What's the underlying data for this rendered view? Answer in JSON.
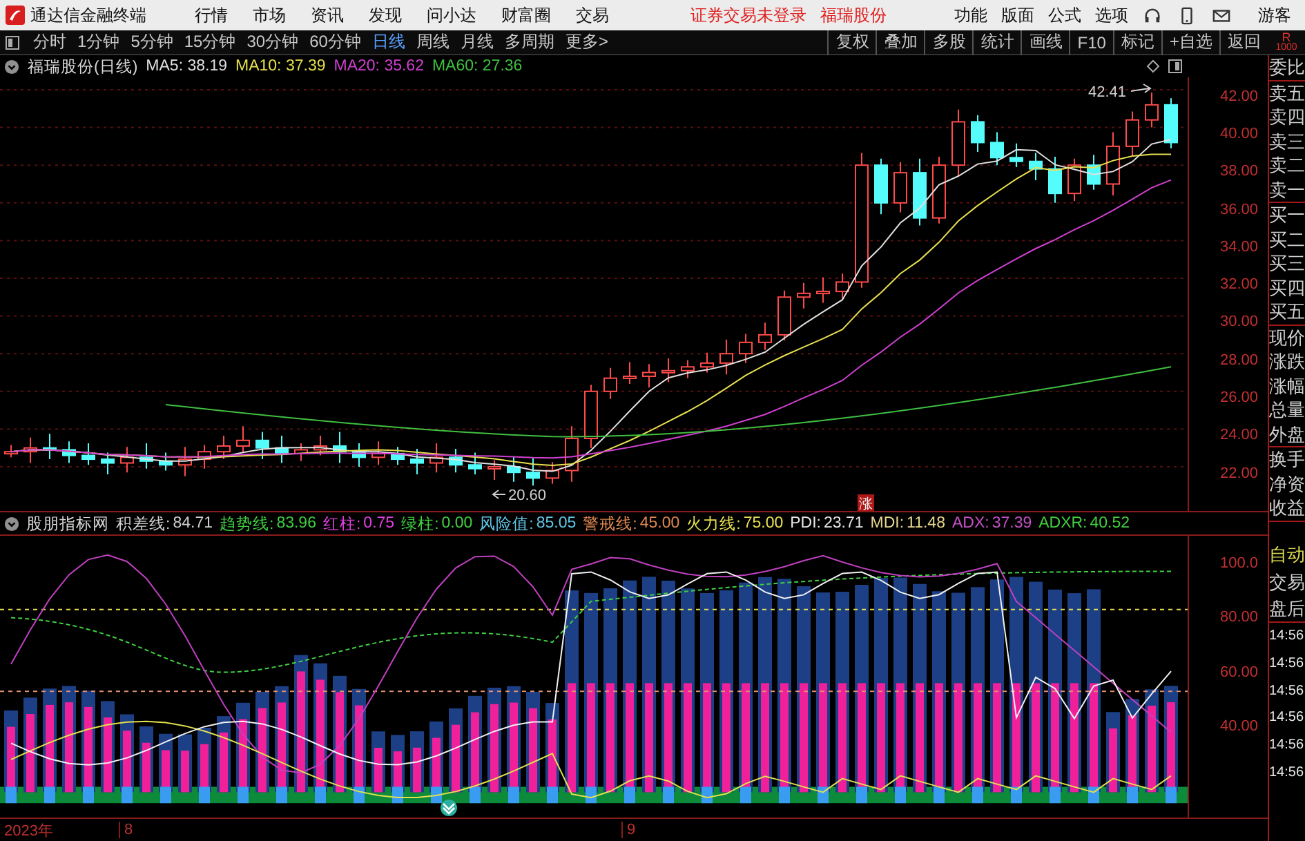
{
  "app": {
    "title": "通达信金融终端"
  },
  "menu": [
    "行情",
    "市场",
    "资讯",
    "发现",
    "问小达",
    "财富圈",
    "交易"
  ],
  "login_status": "证券交易未登录",
  "stock_link": "福瑞股份",
  "right_menu": [
    "功能",
    "版面",
    "公式",
    "选项"
  ],
  "user": "游客",
  "periods": [
    {
      "label": "分时",
      "selected": false
    },
    {
      "label": "1分钟",
      "selected": false
    },
    {
      "label": "5分钟",
      "selected": false
    },
    {
      "label": "15分钟",
      "selected": false
    },
    {
      "label": "30分钟",
      "selected": false
    },
    {
      "label": "60分钟",
      "selected": false
    },
    {
      "label": "日线",
      "selected": true
    },
    {
      "label": "周线",
      "selected": false
    },
    {
      "label": "月线",
      "selected": false
    },
    {
      "label": "多周期",
      "selected": false
    },
    {
      "label": "更多>",
      "selected": false
    }
  ],
  "tools": [
    "复权",
    "叠加",
    "多股",
    "统计",
    "画线",
    "F10",
    "标记",
    "+自选",
    "返回"
  ],
  "corner": {
    "label": "R",
    "value": "1000"
  },
  "main_chart": {
    "title": "福瑞股份(日线)",
    "averages": [
      {
        "label": "MA5:",
        "value": "38.19",
        "color": "#e0e0e0"
      },
      {
        "label": "MA10:",
        "value": "37.39",
        "color": "#e8e050"
      },
      {
        "label": "MA20:",
        "value": "35.62",
        "color": "#d040d0"
      },
      {
        "label": "MA60:",
        "value": "27.36",
        "color": "#40c040"
      }
    ],
    "price_axis": [
      "42.00",
      "40.00",
      "38.00",
      "36.00",
      "34.00",
      "32.00",
      "30.00",
      "28.00",
      "26.00",
      "24.00",
      "22.00"
    ],
    "high_label": "42.41",
    "low_label": "20.60",
    "marker": "涨"
  },
  "indicator": {
    "name": "股朋指标网",
    "values": [
      {
        "label": "积差线:",
        "value": "84.71",
        "color": "#d0d0d0"
      },
      {
        "label": "趋势线:",
        "value": "83.96",
        "color": "#40d040"
      },
      {
        "label": "红柱:",
        "value": "0.75",
        "color": "#e040e0"
      },
      {
        "label": "绿柱:",
        "value": "0.00",
        "color": "#40d040"
      },
      {
        "label": "风险值:",
        "value": "85.05",
        "color": "#60c8e8"
      },
      {
        "label": "警戒线:",
        "value": "45.00",
        "color": "#e08850"
      },
      {
        "label": "火力线:",
        "value": "75.00",
        "color": "#e8e050"
      },
      {
        "label": "PDI:",
        "value": "23.71",
        "color": "#e8e8e8"
      },
      {
        "label": "MDI:",
        "value": "11.48",
        "color": "#e8d890"
      },
      {
        "label": "ADX:",
        "value": "37.39",
        "color": "#c850c8"
      },
      {
        "label": "ADXR:",
        "value": "40.52",
        "color": "#40d040"
      }
    ],
    "axis": [
      "100.0",
      "80.00",
      "60.00",
      "40.00"
    ]
  },
  "date_axis": [
    "2023年",
    "8",
    "9"
  ],
  "quote_panel": {
    "groups": [
      [
        "委比"
      ],
      [
        "卖五",
        "卖四",
        "卖三",
        "卖二",
        "卖一"
      ],
      [
        "买一",
        "买二",
        "买三",
        "买四",
        "买五"
      ],
      [
        "现价",
        "涨跌",
        "涨幅",
        "总量",
        "外盘"
      ],
      [
        "换手",
        "净资",
        "收益"
      ]
    ]
  },
  "lower_panel": {
    "mode": "自动",
    "labels": [
      "交易",
      "盘后"
    ],
    "times": [
      "14:56",
      "14:56",
      "14:56",
      "14:56",
      "14:56",
      "14:56"
    ]
  }
}
